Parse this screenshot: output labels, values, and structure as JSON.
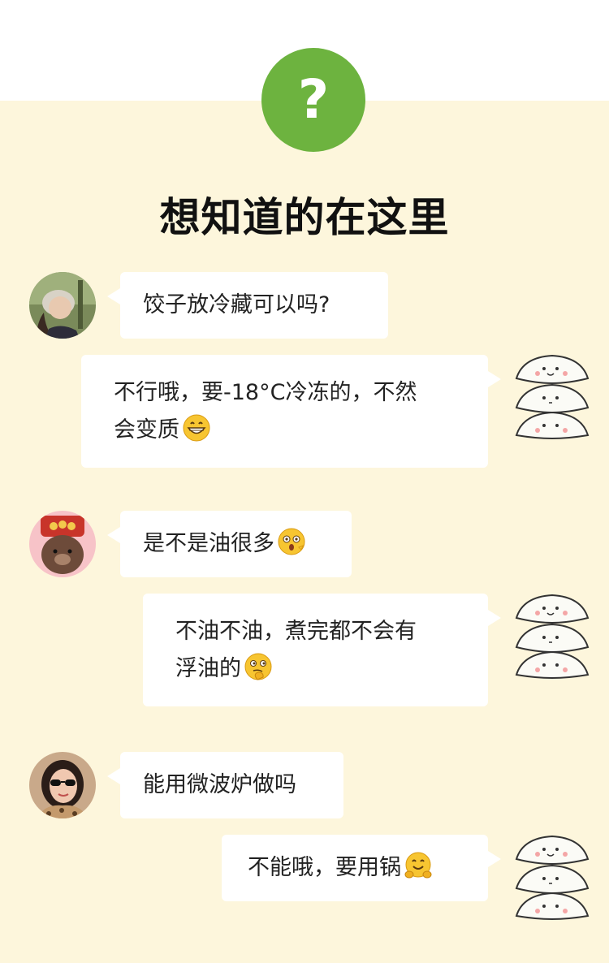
{
  "header": {
    "icon": "question-mark-icon",
    "badge_text": "?",
    "title": "想知道的在这里"
  },
  "colors": {
    "accent": "#6db33f",
    "background": "#fdf6dc",
    "bubble": "#ffffff"
  },
  "chat": [
    {
      "side": "left",
      "avatar": "user-avatar-1",
      "text": "饺子放冷藏可以吗?"
    },
    {
      "side": "right",
      "avatar": "dumpling-avatar",
      "line1": "不行哦，要-18°C冷冻的，不然",
      "line2": "会变质",
      "emoji": "grinning-emoji"
    },
    {
      "side": "left",
      "avatar": "user-avatar-2",
      "text": "是不是油很多",
      "emoji": "surprised-emoji"
    },
    {
      "side": "right",
      "avatar": "dumpling-avatar",
      "line1": "不油不油，煮完都不会有",
      "line2": "浮油的",
      "emoji": "thinking-emoji"
    },
    {
      "side": "left",
      "avatar": "user-avatar-3",
      "text": "能用微波炉做吗"
    },
    {
      "side": "right",
      "avatar": "dumpling-avatar",
      "text": "不能哦，要用锅",
      "emoji": "hugging-emoji"
    }
  ]
}
